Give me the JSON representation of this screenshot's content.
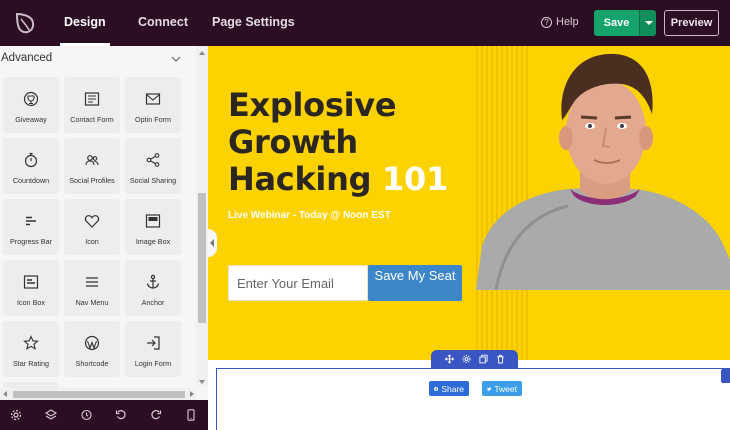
{
  "topbar": {
    "tabs": [
      {
        "label": "Design",
        "active": true
      },
      {
        "label": "Connect",
        "active": false
      },
      {
        "label": "Page Settings",
        "active": false
      }
    ],
    "help_label": "Help",
    "save_label": "Save",
    "preview_label": "Preview"
  },
  "sidebar": {
    "section_title": "Advanced",
    "blocks": [
      {
        "label": "Giveaway",
        "icon": "trophy-icon"
      },
      {
        "label": "Contact Form",
        "icon": "contact-form-icon"
      },
      {
        "label": "Optin Form",
        "icon": "envelope-icon"
      },
      {
        "label": "Countdown",
        "icon": "stopwatch-icon"
      },
      {
        "label": "Social Profiles",
        "icon": "users-icon"
      },
      {
        "label": "Social Sharing",
        "icon": "share-icon"
      },
      {
        "label": "Progress Bar",
        "icon": "progress-bar-icon"
      },
      {
        "label": "Icon",
        "icon": "heart-icon"
      },
      {
        "label": "Image Box",
        "icon": "image-box-icon"
      },
      {
        "label": "Icon Box",
        "icon": "icon-box-icon"
      },
      {
        "label": "Nav Menu",
        "icon": "hamburger-icon"
      },
      {
        "label": "Anchor",
        "icon": "anchor-icon"
      },
      {
        "label": "Star Rating",
        "icon": "star-icon"
      },
      {
        "label": "Shortcode",
        "icon": "wordpress-icon"
      },
      {
        "label": "Login Form",
        "icon": "login-icon"
      }
    ]
  },
  "hero": {
    "headline_line1": "Explosive",
    "headline_line2": "Growth",
    "headline_line3": "Hacking",
    "headline_accent": "101",
    "subline": "Live Webinar - Today @ Noon EST",
    "email_placeholder": "Enter Your Email",
    "cta_label": "Save My Seat"
  },
  "share": {
    "facebook_label": "Share",
    "twitter_label": "Tweet"
  },
  "colors": {
    "topbar_bg": "#2b0d24",
    "save_green": "#13a36b",
    "hero_yellow": "#fcd200",
    "cta_blue": "#3d87c9",
    "section_outline": "#3a56c2"
  }
}
